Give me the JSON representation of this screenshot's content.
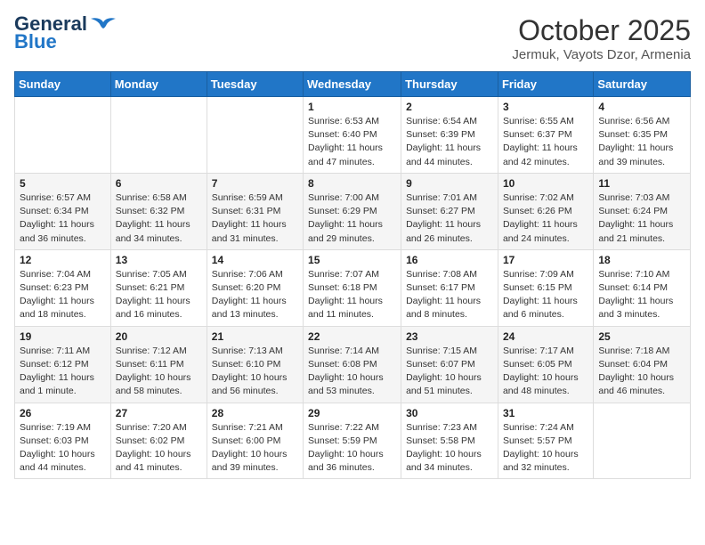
{
  "header": {
    "logo_general": "General",
    "logo_blue": "Blue",
    "title": "October 2025",
    "subtitle": "Jermuk, Vayots Dzor, Armenia"
  },
  "calendar": {
    "headers": [
      "Sunday",
      "Monday",
      "Tuesday",
      "Wednesday",
      "Thursday",
      "Friday",
      "Saturday"
    ],
    "weeks": [
      [
        {
          "day": "",
          "info": ""
        },
        {
          "day": "",
          "info": ""
        },
        {
          "day": "",
          "info": ""
        },
        {
          "day": "1",
          "info": "Sunrise: 6:53 AM\nSunset: 6:40 PM\nDaylight: 11 hours and 47 minutes."
        },
        {
          "day": "2",
          "info": "Sunrise: 6:54 AM\nSunset: 6:39 PM\nDaylight: 11 hours and 44 minutes."
        },
        {
          "day": "3",
          "info": "Sunrise: 6:55 AM\nSunset: 6:37 PM\nDaylight: 11 hours and 42 minutes."
        },
        {
          "day": "4",
          "info": "Sunrise: 6:56 AM\nSunset: 6:35 PM\nDaylight: 11 hours and 39 minutes."
        }
      ],
      [
        {
          "day": "5",
          "info": "Sunrise: 6:57 AM\nSunset: 6:34 PM\nDaylight: 11 hours and 36 minutes."
        },
        {
          "day": "6",
          "info": "Sunrise: 6:58 AM\nSunset: 6:32 PM\nDaylight: 11 hours and 34 minutes."
        },
        {
          "day": "7",
          "info": "Sunrise: 6:59 AM\nSunset: 6:31 PM\nDaylight: 11 hours and 31 minutes."
        },
        {
          "day": "8",
          "info": "Sunrise: 7:00 AM\nSunset: 6:29 PM\nDaylight: 11 hours and 29 minutes."
        },
        {
          "day": "9",
          "info": "Sunrise: 7:01 AM\nSunset: 6:27 PM\nDaylight: 11 hours and 26 minutes."
        },
        {
          "day": "10",
          "info": "Sunrise: 7:02 AM\nSunset: 6:26 PM\nDaylight: 11 hours and 24 minutes."
        },
        {
          "day": "11",
          "info": "Sunrise: 7:03 AM\nSunset: 6:24 PM\nDaylight: 11 hours and 21 minutes."
        }
      ],
      [
        {
          "day": "12",
          "info": "Sunrise: 7:04 AM\nSunset: 6:23 PM\nDaylight: 11 hours and 18 minutes."
        },
        {
          "day": "13",
          "info": "Sunrise: 7:05 AM\nSunset: 6:21 PM\nDaylight: 11 hours and 16 minutes."
        },
        {
          "day": "14",
          "info": "Sunrise: 7:06 AM\nSunset: 6:20 PM\nDaylight: 11 hours and 13 minutes."
        },
        {
          "day": "15",
          "info": "Sunrise: 7:07 AM\nSunset: 6:18 PM\nDaylight: 11 hours and 11 minutes."
        },
        {
          "day": "16",
          "info": "Sunrise: 7:08 AM\nSunset: 6:17 PM\nDaylight: 11 hours and 8 minutes."
        },
        {
          "day": "17",
          "info": "Sunrise: 7:09 AM\nSunset: 6:15 PM\nDaylight: 11 hours and 6 minutes."
        },
        {
          "day": "18",
          "info": "Sunrise: 7:10 AM\nSunset: 6:14 PM\nDaylight: 11 hours and 3 minutes."
        }
      ],
      [
        {
          "day": "19",
          "info": "Sunrise: 7:11 AM\nSunset: 6:12 PM\nDaylight: 11 hours and 1 minute."
        },
        {
          "day": "20",
          "info": "Sunrise: 7:12 AM\nSunset: 6:11 PM\nDaylight: 10 hours and 58 minutes."
        },
        {
          "day": "21",
          "info": "Sunrise: 7:13 AM\nSunset: 6:10 PM\nDaylight: 10 hours and 56 minutes."
        },
        {
          "day": "22",
          "info": "Sunrise: 7:14 AM\nSunset: 6:08 PM\nDaylight: 10 hours and 53 minutes."
        },
        {
          "day": "23",
          "info": "Sunrise: 7:15 AM\nSunset: 6:07 PM\nDaylight: 10 hours and 51 minutes."
        },
        {
          "day": "24",
          "info": "Sunrise: 7:17 AM\nSunset: 6:05 PM\nDaylight: 10 hours and 48 minutes."
        },
        {
          "day": "25",
          "info": "Sunrise: 7:18 AM\nSunset: 6:04 PM\nDaylight: 10 hours and 46 minutes."
        }
      ],
      [
        {
          "day": "26",
          "info": "Sunrise: 7:19 AM\nSunset: 6:03 PM\nDaylight: 10 hours and 44 minutes."
        },
        {
          "day": "27",
          "info": "Sunrise: 7:20 AM\nSunset: 6:02 PM\nDaylight: 10 hours and 41 minutes."
        },
        {
          "day": "28",
          "info": "Sunrise: 7:21 AM\nSunset: 6:00 PM\nDaylight: 10 hours and 39 minutes."
        },
        {
          "day": "29",
          "info": "Sunrise: 7:22 AM\nSunset: 5:59 PM\nDaylight: 10 hours and 36 minutes."
        },
        {
          "day": "30",
          "info": "Sunrise: 7:23 AM\nSunset: 5:58 PM\nDaylight: 10 hours and 34 minutes."
        },
        {
          "day": "31",
          "info": "Sunrise: 7:24 AM\nSunset: 5:57 PM\nDaylight: 10 hours and 32 minutes."
        },
        {
          "day": "",
          "info": ""
        }
      ]
    ]
  }
}
